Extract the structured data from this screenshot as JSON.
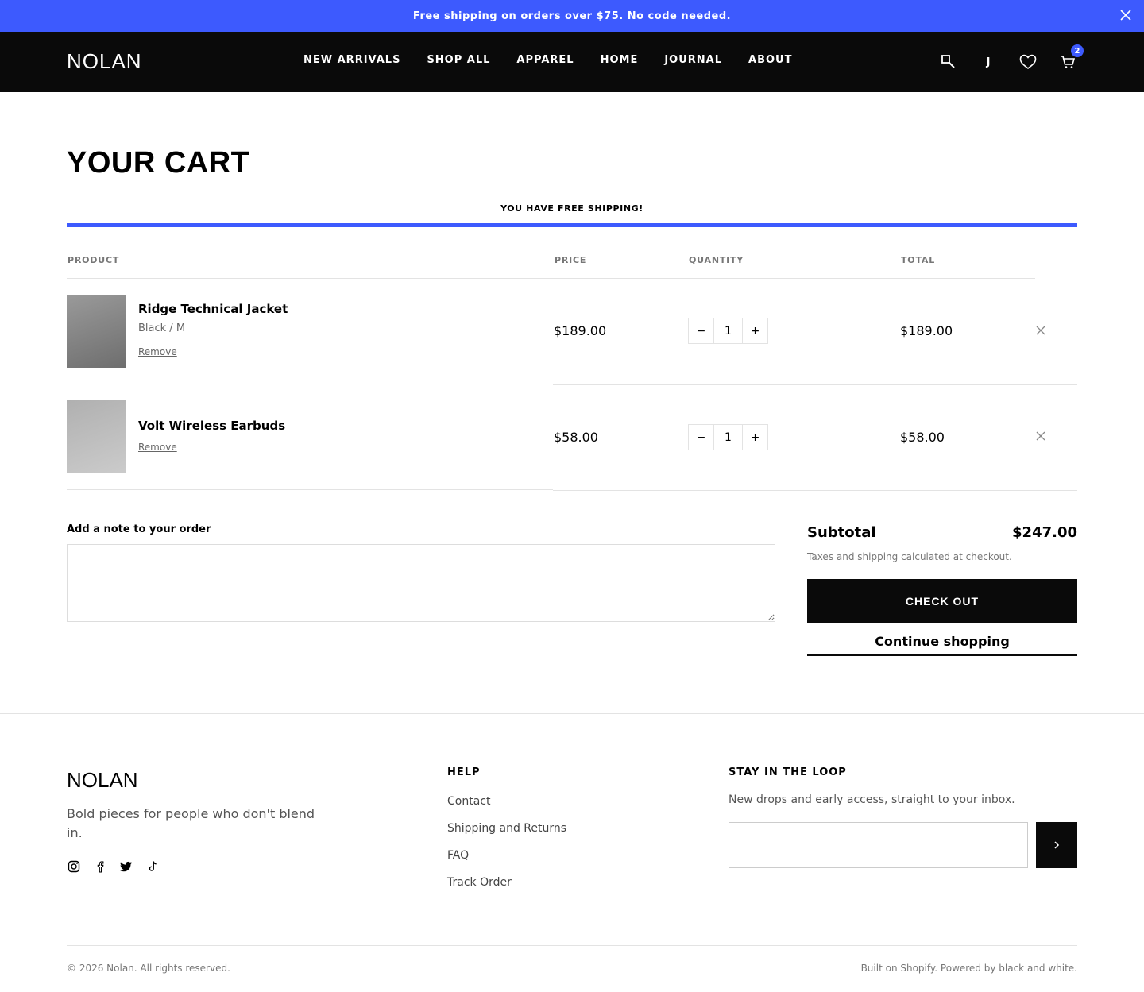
{
  "announcement": {
    "text": "Free shipping on orders over $75. No code needed.",
    "close_icon": "close-icon"
  },
  "header": {
    "logo": "NOLAN",
    "nav": [
      "NEW ARRIVALS",
      "SHOP ALL",
      "APPAREL",
      "HOME",
      "JOURNAL",
      "ABOUT"
    ],
    "account_initial": "J",
    "cart_count": "2",
    "icons": [
      "search-icon",
      "account-icon",
      "wishlist-heart-icon",
      "cart-icon"
    ]
  },
  "cart": {
    "title": "YOUR CART",
    "shipping_message": "YOU HAVE FREE SHIPPING!",
    "shipping_progress": 1.0,
    "columns": {
      "product": "PRODUCT",
      "price": "PRICE",
      "quantity": "QUANTITY",
      "total": "TOTAL"
    },
    "items": [
      {
        "name": "Ridge Technical Jacket",
        "variant": "Black / M",
        "remove": "Remove",
        "price": "$189.00",
        "quantity": "1",
        "total": "$189.00"
      },
      {
        "name": "Volt Wireless Earbuds",
        "variant": "",
        "remove": "Remove",
        "price": "$58.00",
        "quantity": "1",
        "total": "$58.00"
      }
    ],
    "quantity_minus": "−",
    "quantity_plus": "+",
    "note_label": "Add a note to your order",
    "note_value": "",
    "subtotal_label": "Subtotal",
    "subtotal_value": "$247.00",
    "tax_note": "Taxes and shipping calculated at checkout.",
    "checkout_label": "CHECK OUT",
    "continue_label": "Continue shopping"
  },
  "footer": {
    "logo": "NOLAN",
    "tagline": "Bold pieces for people who don't blend in.",
    "socials": [
      "instagram-icon",
      "facebook-icon",
      "twitter-icon",
      "tiktok-icon"
    ],
    "help_heading": "HELP",
    "help_links": [
      "Contact",
      "Shipping and Returns",
      "FAQ",
      "Track Order"
    ],
    "newsletter_heading": "STAY IN THE LOOP",
    "newsletter_text": "New drops and early access, straight to your inbox.",
    "newsletter_placeholder": "",
    "copyright": "© 2026 Nolan. All rights reserved.",
    "powered": "Built on Shopify. Powered by black and white."
  },
  "colors": {
    "accent": "#3d5afe",
    "header_bg": "#0a0a0a",
    "text": "#000000",
    "muted": "#777777"
  }
}
